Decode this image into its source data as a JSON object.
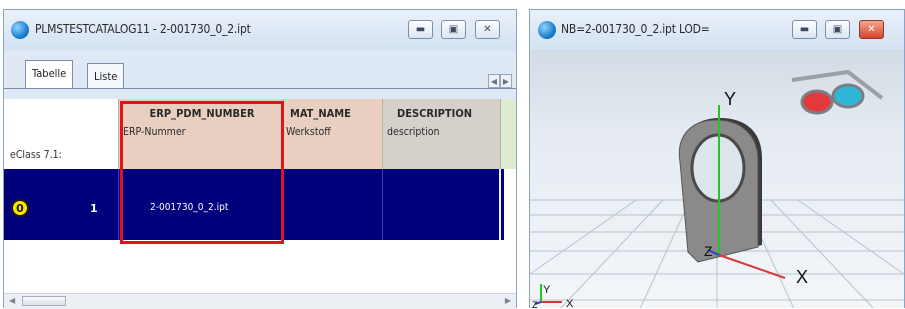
{
  "left_window": {
    "title": "PLMSTESTCATALOG11 - 2-001730_0_2.ipt",
    "tabs": [
      "Tabelle",
      "Liste"
    ],
    "columns": [
      {
        "name": "ERP_PDM_NUMBER",
        "caption": "ERP-Nummer"
      },
      {
        "name": "MAT_NAME",
        "caption": "Werkstoff"
      },
      {
        "name": "DESCRIPTION",
        "caption": "description"
      }
    ],
    "eclass_label": "eClass 7.1:",
    "row": {
      "badge": "0",
      "number": "1",
      "erp_pdm_number": "2-001730_0_2.ipt"
    }
  },
  "right_window": {
    "title": "NB=2-001730_0_2.ipt LOD=",
    "axes": {
      "y": "Y",
      "x": "X",
      "z": "Z"
    }
  },
  "colors": {
    "row_selected": "#00007d",
    "header_bg": "#e8cfc0",
    "highlight": "#e4101c"
  }
}
